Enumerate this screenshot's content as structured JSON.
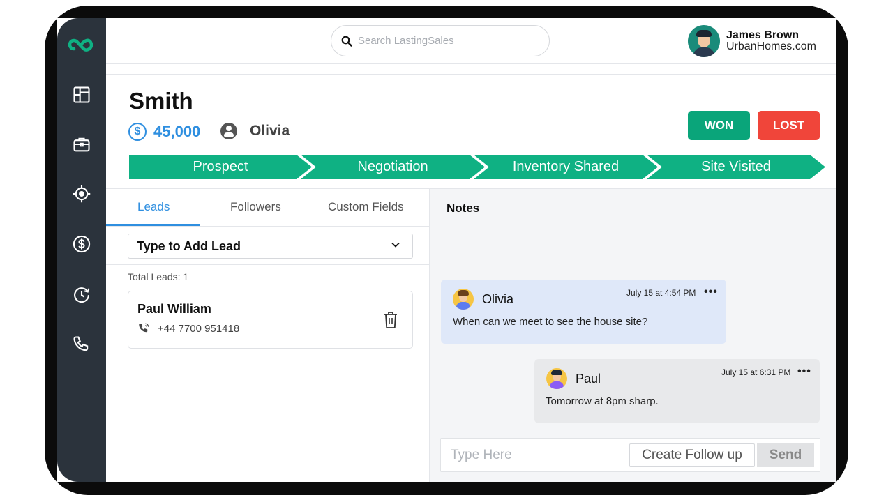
{
  "search": {
    "placeholder": "Search LastingSales",
    "icon": "search-icon"
  },
  "user": {
    "name": "James Brown",
    "company": "UrbanHomes.com"
  },
  "sidebar": {
    "logo": "lastingsales-logo",
    "items": [
      {
        "icon": "dashboard-icon"
      },
      {
        "icon": "briefcase-icon"
      },
      {
        "icon": "target-icon"
      },
      {
        "icon": "dollar-icon"
      },
      {
        "icon": "history-icon"
      },
      {
        "icon": "phone-icon"
      }
    ]
  },
  "deal": {
    "title": "Smith",
    "currency_symbol": "$",
    "amount": "45,000",
    "owner": "Olivia",
    "won_label": "WON",
    "lost_label": "LOST",
    "stages": [
      "Prospect",
      "Negotiation",
      "Inventory Shared",
      "Site Visited"
    ]
  },
  "colors": {
    "accent": "#2f8fe0",
    "stage": "#0fb183",
    "won": "#0aa57a",
    "lost": "#f0453a",
    "sidebar": "#2b333c"
  },
  "tabs": [
    "Leads",
    "Followers",
    "Custom Fields"
  ],
  "leads": {
    "add_placeholder": "Type to Add Lead",
    "total_label": "Total Leads: 1",
    "items": [
      {
        "name": "Paul William",
        "phone": "+44 7700 951418"
      }
    ]
  },
  "notes": {
    "title": "Notes",
    "messages": [
      {
        "author": "Olivia",
        "time": "July 15 at 4:54 PM",
        "text": "When can we meet to see the house site?"
      },
      {
        "author": "Paul",
        "time": "July 15 at 6:31 PM",
        "text": "Tomorrow at 8pm sharp."
      }
    ],
    "menu_glyph": "•••",
    "composer_placeholder": "Type Here",
    "follow_up_label": "Create Follow up",
    "send_label": "Send"
  }
}
